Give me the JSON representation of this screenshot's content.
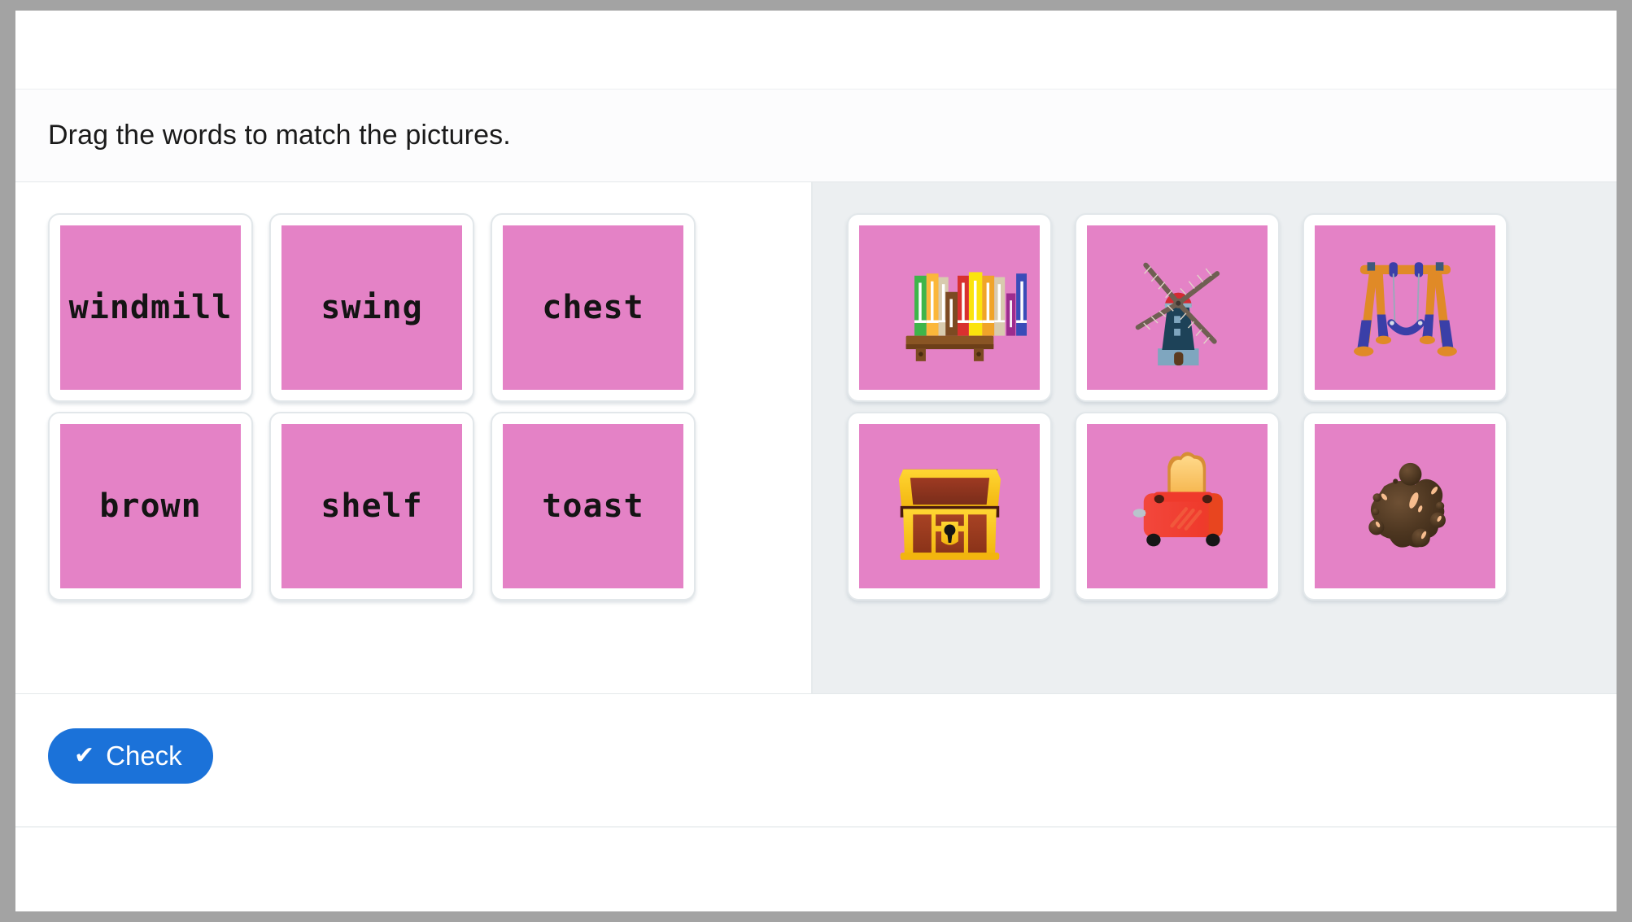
{
  "app": {
    "instruction": "Drag the words to match the pictures.",
    "accent_color": "#1b72d9",
    "tile_color": "#e482c6",
    "panel_bg": "#eceff1"
  },
  "words_panel": {
    "name": "word-tiles",
    "tiles": [
      {
        "label": "windmill"
      },
      {
        "label": "swing"
      },
      {
        "label": "chest"
      },
      {
        "label": "brown"
      },
      {
        "label": "shelf"
      },
      {
        "label": "toast"
      }
    ]
  },
  "pictures_panel": {
    "name": "picture-tiles",
    "tiles": [
      {
        "icon": "bookshelf-icon",
        "alt": "shelf"
      },
      {
        "icon": "windmill-icon",
        "alt": "windmill"
      },
      {
        "icon": "swing-icon",
        "alt": "swing"
      },
      {
        "icon": "treasure-chest-icon",
        "alt": "chest"
      },
      {
        "icon": "toaster-icon",
        "alt": "toast"
      },
      {
        "icon": "brown-splat-icon",
        "alt": "brown"
      }
    ]
  },
  "footer": {
    "check_label": "Check",
    "check_icon": "checkmark-icon",
    "check_glyph": "✔"
  }
}
